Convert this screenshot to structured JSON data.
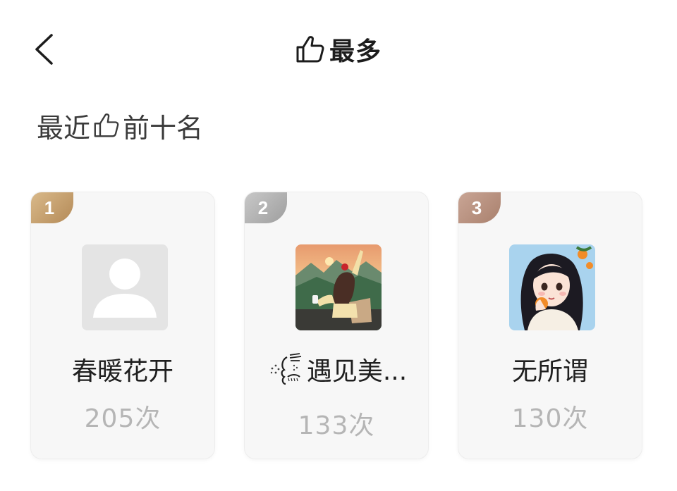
{
  "header": {
    "title": "最多",
    "back_icon": "chevron-left-icon",
    "title_icon": "thumbs-up-icon"
  },
  "section": {
    "prefix": "最近",
    "suffix": "前十名",
    "icon": "thumbs-up-icon"
  },
  "rankings": [
    {
      "rank": "1",
      "name": "春暖花开",
      "count": "205次",
      "badge_color": "#c29a66"
    },
    {
      "rank": "2",
      "name": "遇见美...",
      "count": "133次",
      "badge_color": "#b0b0b0"
    },
    {
      "rank": "3",
      "name": "无所谓",
      "count": "130次",
      "badge_color": "#b48f7f"
    }
  ]
}
